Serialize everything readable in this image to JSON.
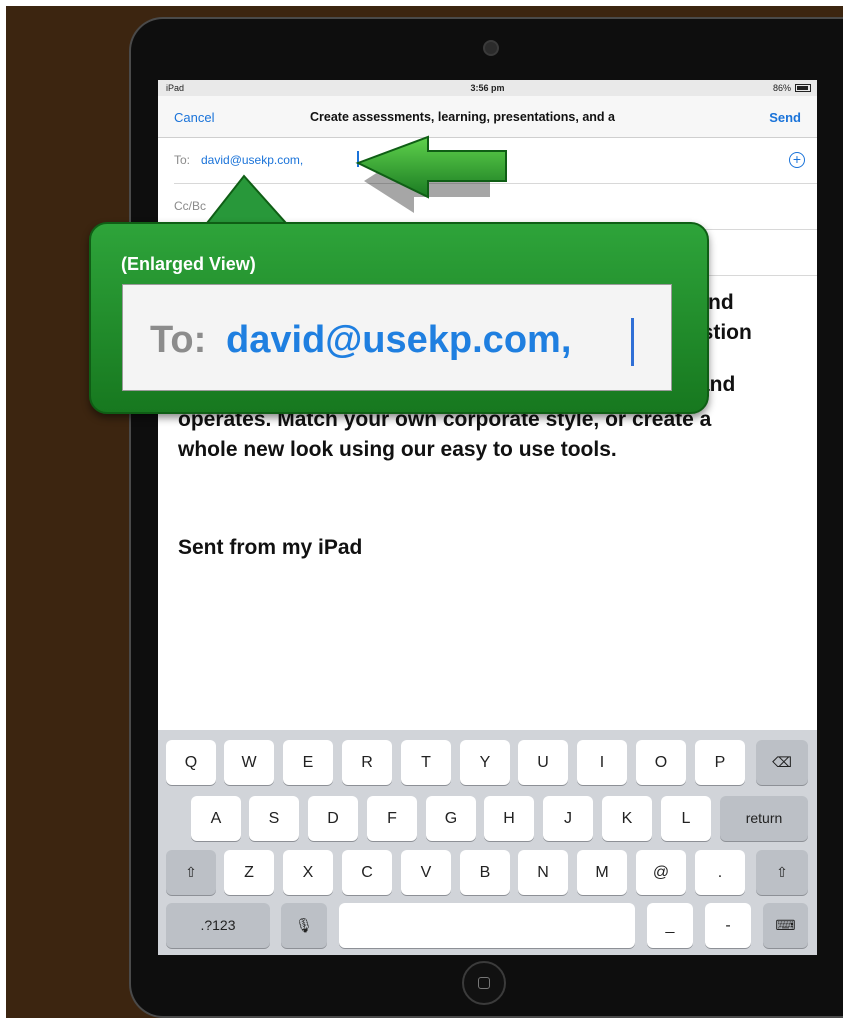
{
  "status_bar": {
    "device": "iPad",
    "time": "3:56 pm",
    "battery": "86%"
  },
  "nav": {
    "cancel": "Cancel",
    "title": "Create assessments, learning, presentations, and a",
    "send": "Send"
  },
  "fields": {
    "to_label": "To:",
    "to_value": "david@usekp.com,",
    "cc_label": "Cc/Bc"
  },
  "body": {
    "line1": "nd",
    "line2": "estion",
    "line3": "and",
    "line4": "operates. Match your own corporate style, or create a",
    "line5": "whole new look using our easy to use tools.",
    "signature": "Sent from my iPad"
  },
  "callout": {
    "title": "(Enlarged View)",
    "label": "To:",
    "value": "david@usekp.com,"
  },
  "keyboard": {
    "row1": [
      "Q",
      "W",
      "E",
      "R",
      "T",
      "Y",
      "U",
      "I",
      "O",
      "P"
    ],
    "row2": [
      "A",
      "S",
      "D",
      "F",
      "G",
      "H",
      "J",
      "K",
      "L"
    ],
    "return": "return",
    "row3": [
      "Z",
      "X",
      "C",
      "V",
      "B",
      "N",
      "M",
      "@",
      "."
    ],
    "numbers": ".?123",
    "underscore": "_",
    "dash": "-"
  },
  "colors": {
    "accent": "#1a73d9",
    "callout_green": "#22902e",
    "backdrop": "#3c2510"
  },
  "icons": {
    "add": "add-contact-icon",
    "backspace": "backspace-icon",
    "shift": "shift-icon",
    "mic": "microphone-icon",
    "keyboard": "keyboard-dismiss-icon",
    "arrow": "pointer-arrow-icon"
  }
}
